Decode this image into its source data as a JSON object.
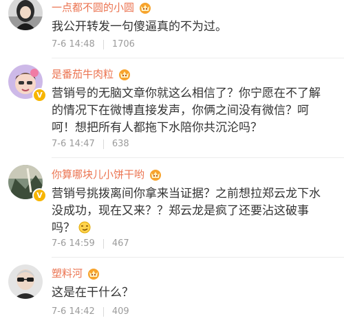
{
  "comments": [
    {
      "username": "一点都不圆的小圆",
      "content": "我公开转发一句傻逼真的不为过。",
      "date": "7-6 14:48",
      "likes": "1706",
      "verified": false,
      "vip_icon": "vip-crown-icon"
    },
    {
      "username": "是番茄牛肉粒",
      "content": "营销号的无脑文章你就这么相信了？你宁愿在不了解的情况下在微博直接发声，你俩之间没有微信？呵呵！想把所有人都拖下水陪你共沉沦吗？",
      "date": "7-6 14:47",
      "likes": "638",
      "verified": true,
      "vip_icon": "vip-crown-icon"
    },
    {
      "username": "你算哪块儿小饼干哟",
      "content": "营销号挑拨离间你拿来当证据？之前想拉郑云龙下水没成功，现在又来？？郑云龙是疯了还要沾这破事吗？",
      "date": "7-6 14:59",
      "likes": "467",
      "verified": true,
      "vip_icon": "vip-crown-icon",
      "emoji": "smirk-emoji"
    },
    {
      "username": "塑料河",
      "content": "这是在干什么？",
      "date": "7-6 14:42",
      "likes": "409",
      "verified": false,
      "vip_icon": "vip-crown-icon"
    }
  ],
  "verified_badge_text": "V",
  "colors": {
    "username": "#eb7350",
    "content": "#333333",
    "meta": "#9b9b9b",
    "badge": "#f7b500"
  }
}
